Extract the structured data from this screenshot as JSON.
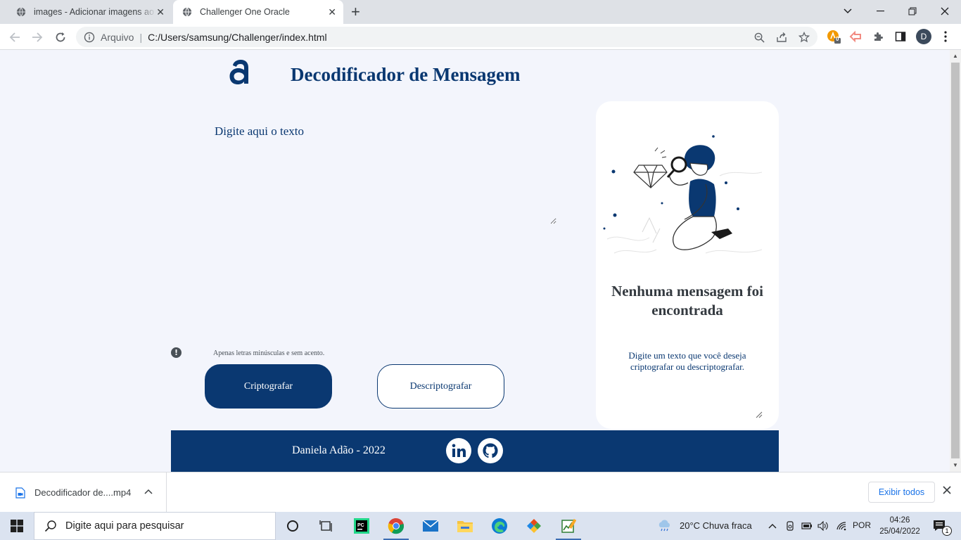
{
  "browser": {
    "tabs": [
      {
        "title": "images - Adicionar imagens ao README",
        "active": false
      },
      {
        "title": "Challenger One Oracle",
        "active": true
      }
    ],
    "omnibox": {
      "scheme_label": "Arquivo",
      "url": "C:/Users/samsung/Challenger/index.html"
    },
    "profile_initial": "D",
    "extension_badge": "0"
  },
  "page": {
    "title": "Decodificador de Mensagem",
    "input_placeholder": "Digite aqui o texto",
    "warning_icon": "!",
    "warning": "Apenas letras minúsculas e sem acento.",
    "buttons": {
      "encrypt": "Criptografar",
      "decrypt": "Descriptografar"
    },
    "output": {
      "title": "Nenhuma mensagem foi encontrada",
      "subtitle": "Digite um texto que você deseja criptografar ou descriptografar."
    },
    "footer": {
      "credit": "Daniela Adão - 2022"
    },
    "colors": {
      "primary": "#0a3871",
      "background": "#f3f5fc"
    }
  },
  "downloads": {
    "item_name": "Decodificador de....mp4",
    "show_all": "Exibir todos"
  },
  "taskbar": {
    "search_placeholder": "Digite aqui para pesquisar",
    "weather": "20°C  Chuva fraca",
    "language": "POR",
    "time": "04:26",
    "date": "25/04/2022",
    "notification_count": "1"
  }
}
